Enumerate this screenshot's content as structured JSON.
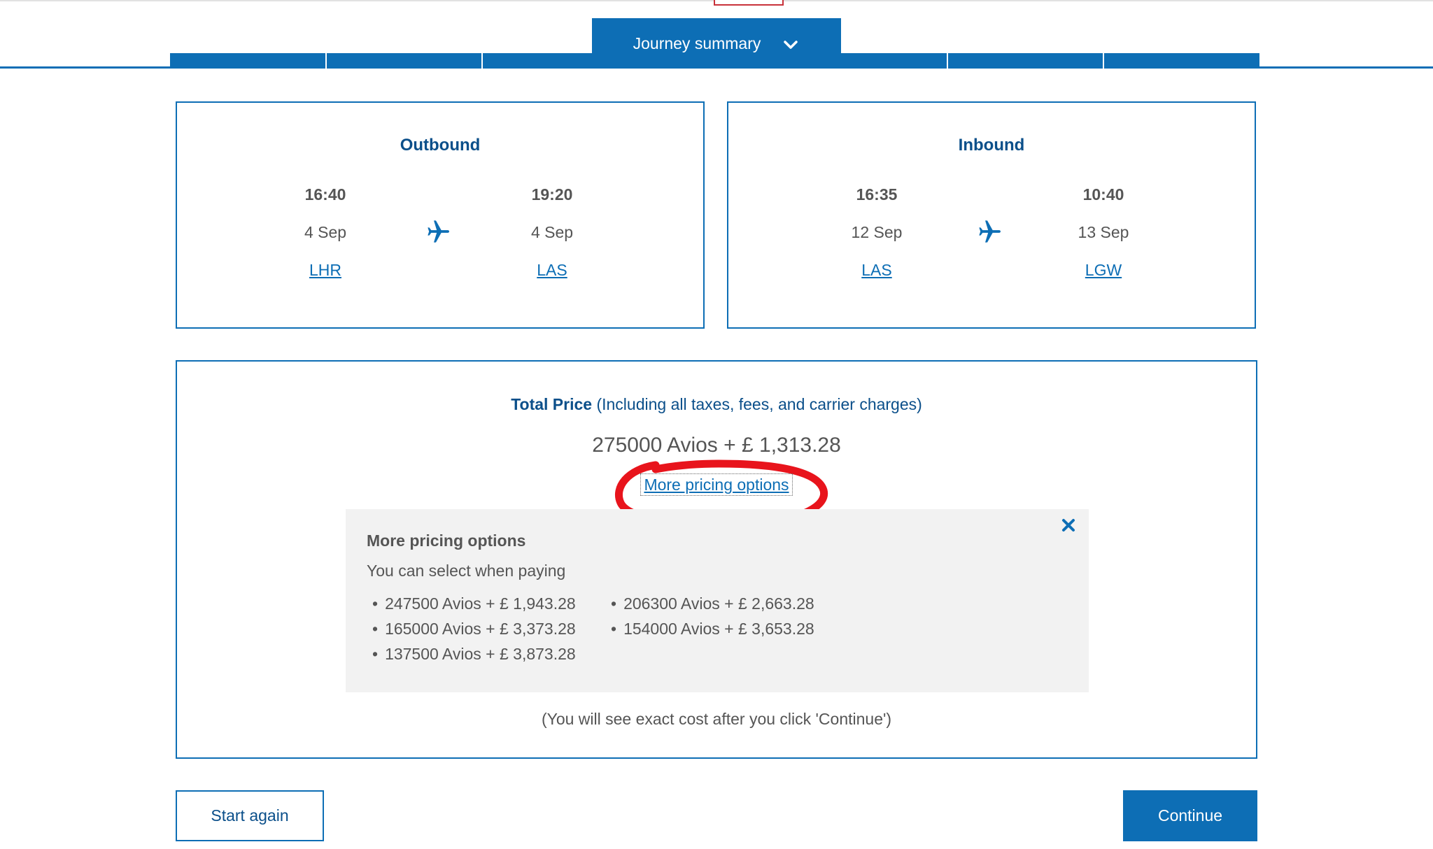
{
  "header": {
    "journey_tab_label": "Journey summary"
  },
  "outbound": {
    "title": "Outbound",
    "departure": {
      "time": "16:40",
      "date": "4 Sep",
      "airport": "LHR"
    },
    "arrival": {
      "time": "19:20",
      "date": "4 Sep",
      "airport": "LAS"
    }
  },
  "inbound": {
    "title": "Inbound",
    "departure": {
      "time": "16:35",
      "date": "12 Sep",
      "airport": "LAS"
    },
    "arrival": {
      "time": "10:40",
      "date": "13 Sep",
      "airport": "LGW"
    }
  },
  "price": {
    "label_bold": "Total Price",
    "label_rest": " (Including all taxes, fees, and carrier charges)",
    "value": "275000 Avios + £ 1,313.28",
    "more_link": "More pricing options",
    "panel": {
      "title": "More pricing options",
      "subtitle": "You can select when paying",
      "options": [
        "247500 Avios + £ 1,943.28",
        "206300 Avios + £ 2,663.28",
        "165000 Avios + £ 3,373.28",
        "154000 Avios + £ 3,653.28",
        "137500 Avios + £ 3,873.28"
      ]
    },
    "note": "(You will see exact cost after you click 'Continue')"
  },
  "actions": {
    "start_again": "Start again",
    "continue": "Continue"
  },
  "colors": {
    "brand_blue": "#0d6eb5",
    "heading_blue": "#0b4f8a",
    "annotation_red": "#e8141c"
  },
  "icons": {
    "journey_toggle": "chevron-down-icon",
    "flight": "plane-icon",
    "panel_close": "close-icon"
  }
}
